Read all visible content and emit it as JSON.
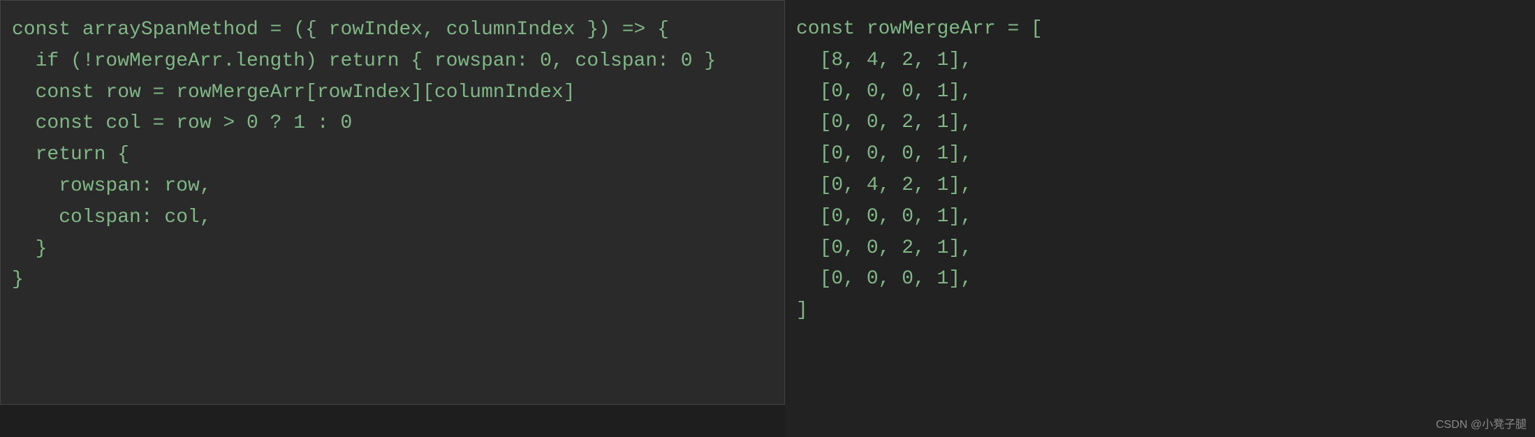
{
  "left_panel": {
    "lines": [
      "const arraySpanMethod = ({ rowIndex, columnIndex }) => {",
      "  if (!rowMergeArr.length) return { rowspan: 0, colspan: 0 }",
      "  const row = rowMergeArr[rowIndex][columnIndex]",
      "  const col = row > 0 ? 1 : 0",
      "  return {",
      "    rowspan: row,",
      "    colspan: col,",
      "  }",
      "}"
    ]
  },
  "right_panel": {
    "lines": [
      "const rowMergeArr = [",
      "  [8, 4, 2, 1],",
      "  [0, 0, 0, 1],",
      "  [0, 0, 2, 1],",
      "  [0, 0, 0, 1],",
      "  [0, 4, 2, 1],",
      "  [0, 0, 0, 1],",
      "  [0, 0, 2, 1],",
      "  [0, 0, 0, 1],",
      "]"
    ]
  },
  "watermark": "CSDN @小凳子腿"
}
